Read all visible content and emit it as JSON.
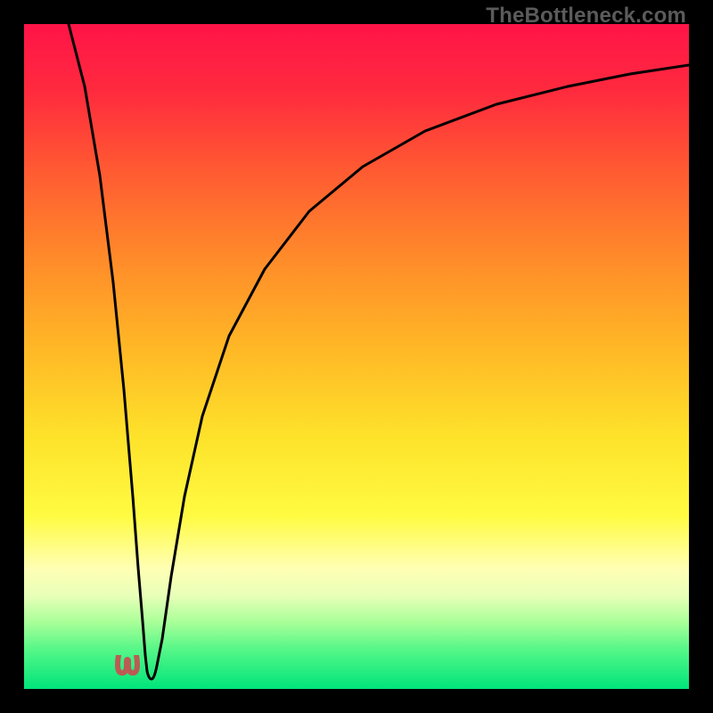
{
  "watermark": "TheBottleneck.com",
  "colors": {
    "frame": "#000000",
    "curve": "#000000",
    "nub": "#bb5b53",
    "gradient_top": "#ff1448",
    "gradient_bottom": "#00e47a"
  },
  "chart_data": {
    "type": "line",
    "title": "",
    "xlabel": "",
    "ylabel": "",
    "xlim": [
      0,
      100
    ],
    "ylim": [
      0,
      100
    ],
    "grid": false,
    "legend": false,
    "series": [
      {
        "name": "left-branch",
        "x": [
          7,
          8,
          10,
          12,
          14,
          15,
          16,
          17,
          18
        ],
        "y": [
          100,
          87,
          71,
          50,
          29,
          18,
          10,
          4,
          1.5
        ]
      },
      {
        "name": "right-branch",
        "x": [
          19,
          20,
          22,
          25,
          30,
          35,
          40,
          50,
          60,
          70,
          80,
          90,
          100
        ],
        "y": [
          1.5,
          6,
          18,
          33,
          50,
          61,
          69,
          78,
          83,
          87,
          90,
          92.5,
          94
        ]
      },
      {
        "name": "valley-floor",
        "x": [
          17.5,
          18,
          18.5,
          19,
          19.5
        ],
        "y": [
          1.2,
          0.9,
          1.0,
          0.9,
          1.2
        ]
      }
    ],
    "min_point": {
      "x": 18.5,
      "y": 0.9
    }
  }
}
